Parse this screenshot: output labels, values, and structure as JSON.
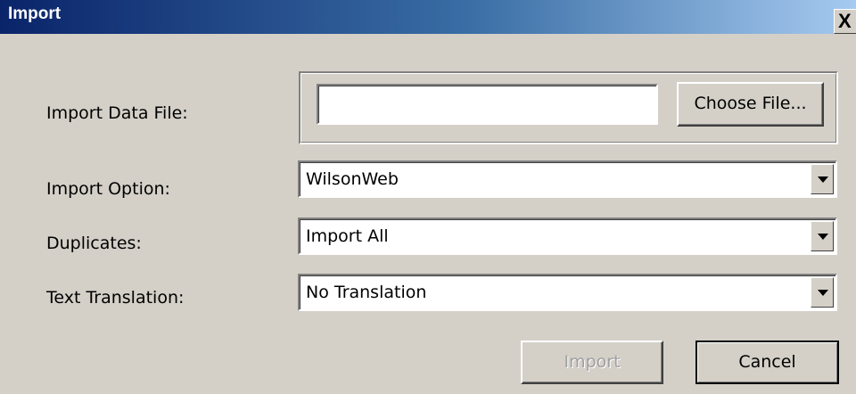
{
  "window": {
    "title": "Import",
    "close_glyph": "X"
  },
  "data_file": {
    "label": "Import Data File:",
    "value": "",
    "choose_label": "Choose File..."
  },
  "import_option": {
    "label": "Import Option:",
    "selected": "WilsonWeb"
  },
  "duplicates": {
    "label": "Duplicates:",
    "selected": "Import All"
  },
  "text_translation": {
    "label": "Text Translation:",
    "selected": "No Translation"
  },
  "buttons": {
    "import_label": "Import",
    "import_disabled": true,
    "cancel_label": "Cancel"
  },
  "icons": {
    "close": "close-icon",
    "dropdown": "chevron-down-icon"
  },
  "colors": {
    "titlebar_start": "#0a246a",
    "titlebar_end": "#a6caf0",
    "face": "#d4d0c8",
    "disabled_text": "#a0a0a0"
  }
}
